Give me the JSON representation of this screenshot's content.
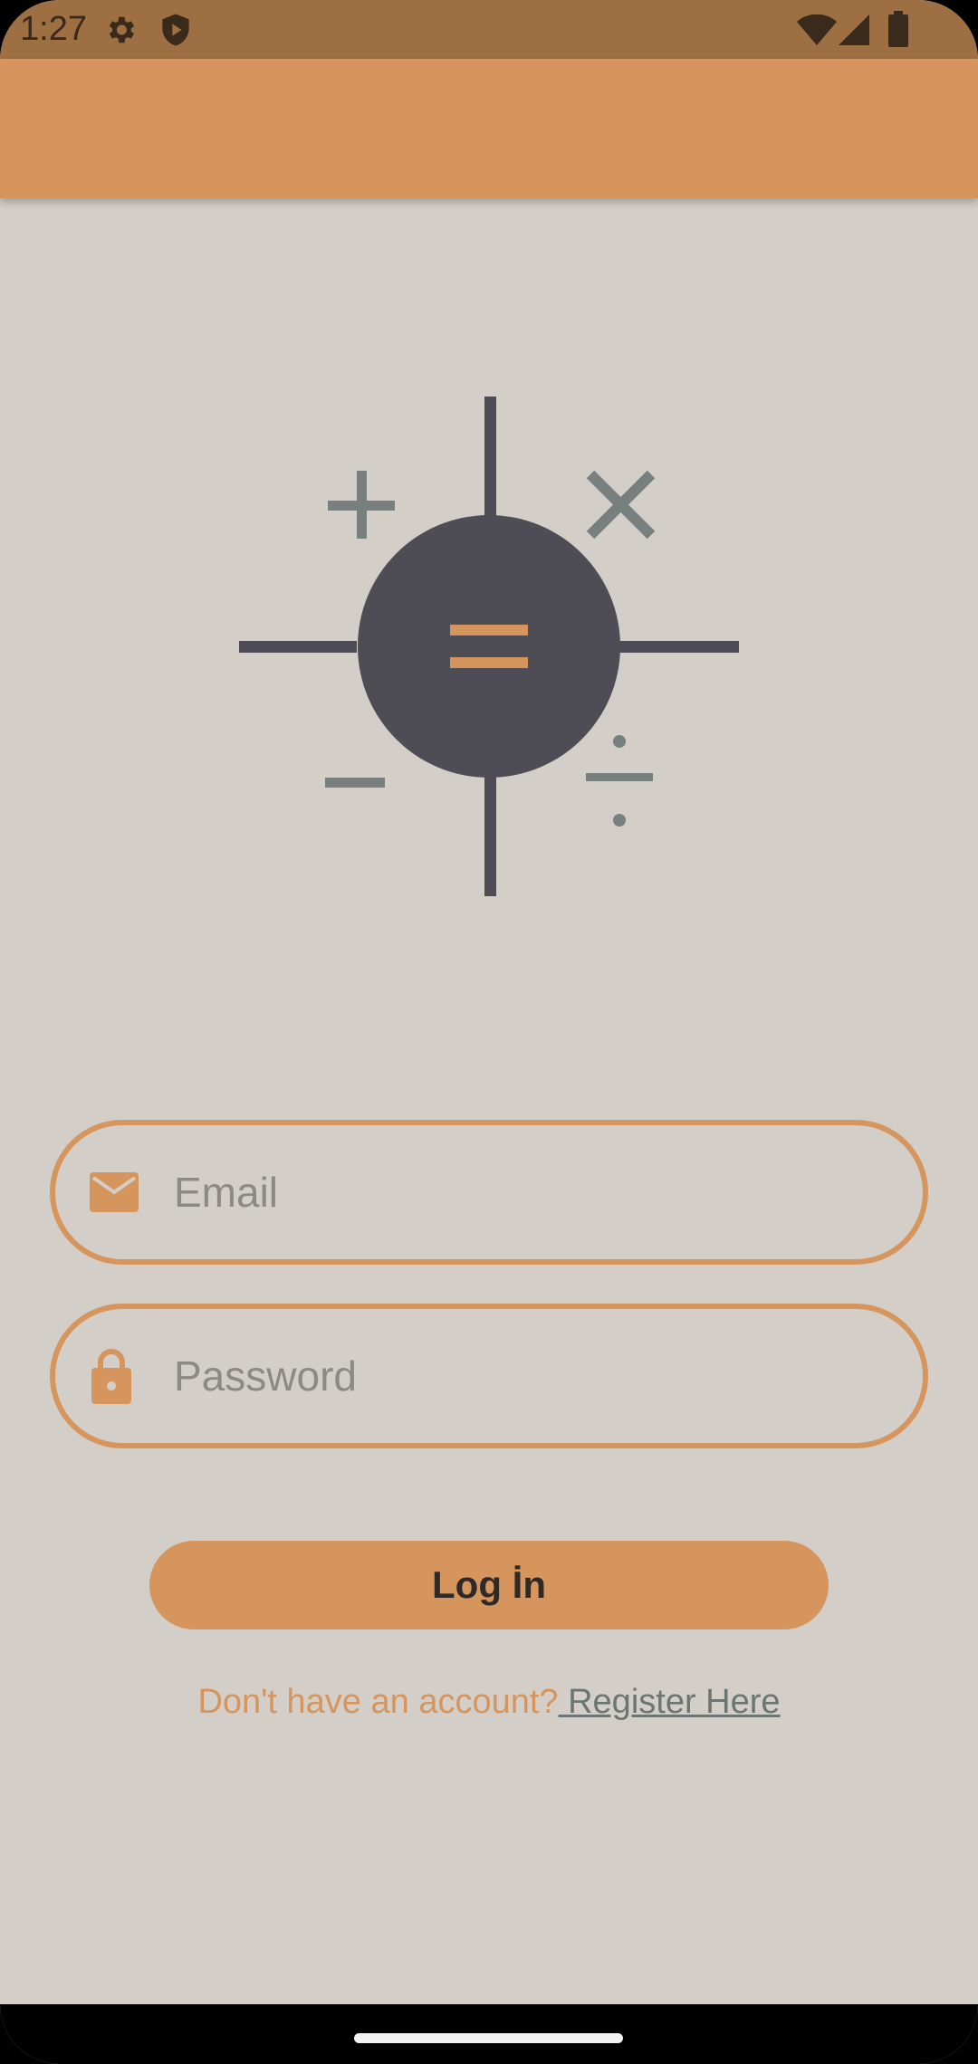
{
  "status_bar": {
    "time": "1:27",
    "icons": [
      "settings-icon",
      "shield-play-icon",
      "wifi-icon",
      "cell-signal-icon",
      "battery-icon"
    ]
  },
  "logo": {
    "icon": "calculator-logo-icon",
    "symbols": [
      "+",
      "×",
      "−",
      "÷",
      "="
    ]
  },
  "login_form": {
    "email": {
      "placeholder": "Email",
      "value": "",
      "icon": "email-icon"
    },
    "password": {
      "placeholder": "Password",
      "value": "",
      "icon": "lock-icon"
    },
    "login_label": "Log İn",
    "register_prompt": "Don't have an account?",
    "register_link": " Register Here"
  },
  "colors": {
    "status_bar": "#9e6f43",
    "app_bar": "#d6955d",
    "background": "#d3cec7",
    "accent": "#d6955d",
    "logo_dark": "#4e4d55",
    "logo_gray": "#77807f",
    "link_gray": "#6b7574"
  }
}
